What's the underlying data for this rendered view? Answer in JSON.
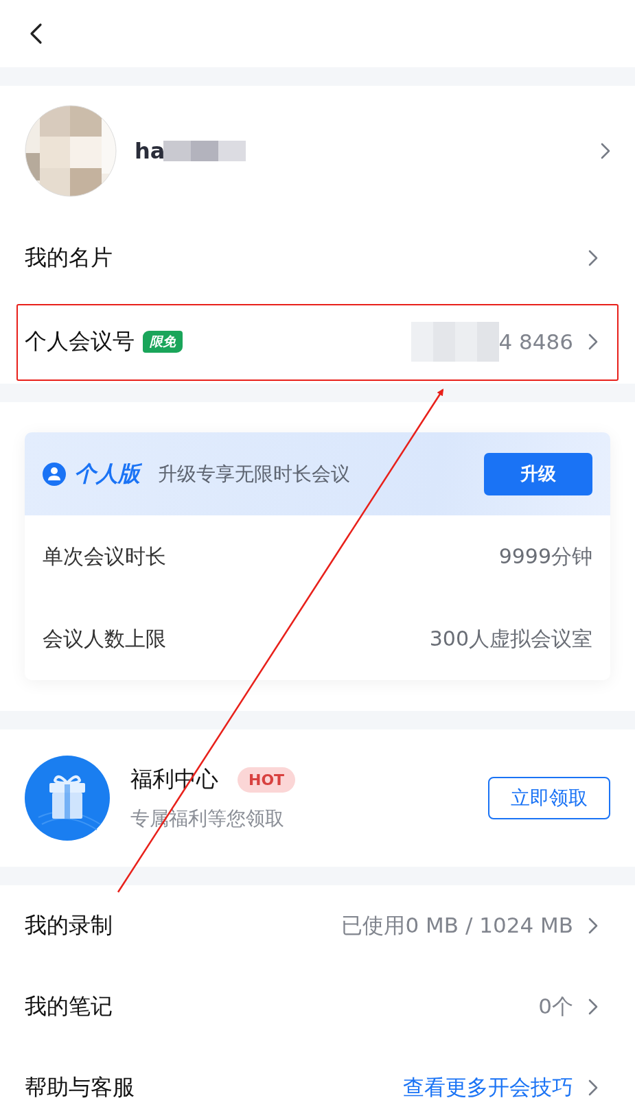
{
  "profile": {
    "name": "ha"
  },
  "menu_top": [
    {
      "label": "我的名片",
      "kind": "plain"
    },
    {
      "label": "个人会议号",
      "kind": "meeting",
      "badge": "限免",
      "value": "4 8486"
    }
  ],
  "plan_card": {
    "title": "个人版",
    "subtitle": "升级专享无限时长会议",
    "button": "升级",
    "rows": [
      {
        "label": "单次会议时长",
        "value": "9999分钟"
      },
      {
        "label": "会议人数上限",
        "value": "300人虚拟会议室"
      }
    ]
  },
  "welfare": {
    "title": "福利中心",
    "badge": "HOT",
    "subtitle": "专属福利等您领取",
    "button": "立即领取"
  },
  "menu_bottom": [
    {
      "label": "我的录制",
      "value": "已使用0 MB / 1024 MB",
      "kind": "muted"
    },
    {
      "label": "我的笔记",
      "value": "0个",
      "kind": "muted"
    },
    {
      "label": "帮助与客服",
      "value": "查看更多开会技巧",
      "kind": "link"
    }
  ]
}
